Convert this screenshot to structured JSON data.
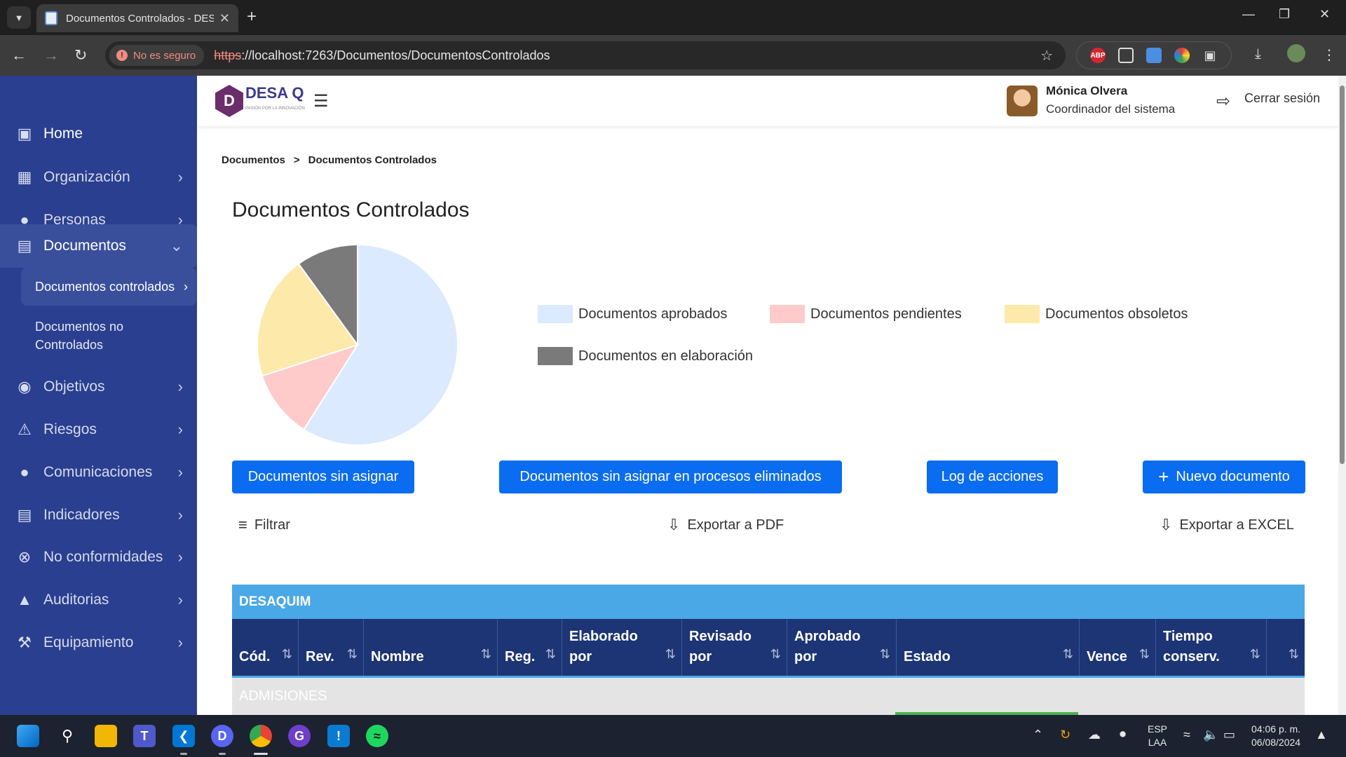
{
  "browser": {
    "tab_title": "Documentos Controlados - DES",
    "security_label": "No es seguro",
    "url_scheme": "https",
    "url_rest": "://localhost:7263/Documentos/DocumentosControlados",
    "extension_abp": "ABP"
  },
  "sidebar": {
    "items": [
      {
        "label": "Home",
        "icon": "home-icon"
      },
      {
        "label": "Organizacion",
        "icon": "building-icon"
      },
      {
        "label": "Personas",
        "icon": "person-icon"
      },
      {
        "label": "Documentos",
        "icon": "book-icon"
      },
      {
        "label": "Objetivos",
        "icon": "target-icon"
      },
      {
        "label": "Riesgos",
        "icon": "warning-icon"
      },
      {
        "label": "Comunicaciones",
        "icon": "chat-icon"
      },
      {
        "label": "Indicadores",
        "icon": "chart-icon"
      },
      {
        "label": "No conformidades",
        "icon": "circle-x-icon"
      },
      {
        "label": "Auditorias",
        "icon": "bell-icon"
      },
      {
        "label": "Equipamiento",
        "icon": "tools-icon"
      }
    ],
    "org_label": "Organización",
    "subitems": {
      "controlled": "Documentos controlados",
      "uncontrolled": "Documentos no Controlados"
    }
  },
  "header": {
    "logo_text": "DESA Q",
    "logo_tagline": "PASIÓN POR LA INNOVACIÓN",
    "user_name": "Mónica Olvera",
    "user_role": "Coordinador del sistema",
    "logout_label": "Cerrar sesión"
  },
  "breadcrumb": {
    "root": "Documentos",
    "sep": ">",
    "current": "Documentos Controlados"
  },
  "page_title": "Documentos Controlados",
  "chart_data": {
    "type": "pie",
    "title": "",
    "slices": [
      {
        "label": "Documentos aprobados",
        "value": 59,
        "color": "#dbeafe"
      },
      {
        "label": "Documentos pendientes",
        "value": 11,
        "color": "#fecaca"
      },
      {
        "label": "Documentos obsoletos",
        "value": 20,
        "color": "#fde9a9"
      },
      {
        "label": "Documentos en elaboración",
        "value": 10,
        "color": "#7a7a7a"
      }
    ],
    "legend_position": "right"
  },
  "buttons": {
    "unassigned": "Documentos sin asignar",
    "unassigned_deleted": "Documentos sin asignar en procesos eliminados",
    "log": "Log de acciones",
    "new_doc": "Nuevo documento"
  },
  "actions": {
    "filter": "Filtrar",
    "export_pdf": "Exportar a PDF",
    "export_excel": "Exportar a EXCEL"
  },
  "table": {
    "group": "DESAQUIM",
    "subgroup": "ADMISIONES",
    "columns": [
      "Cód.",
      "Rev.",
      "Nombre",
      "Reg.",
      "Elaborado por",
      "Revisado por",
      "Aprobado por",
      "Estado",
      "Vence",
      "Tiempo conserv.",
      ""
    ]
  },
  "taskbar": {
    "lang_top": "ESP",
    "lang_bottom": "LAA",
    "time": "04:06 p. m.",
    "date": "06/08/2024"
  }
}
